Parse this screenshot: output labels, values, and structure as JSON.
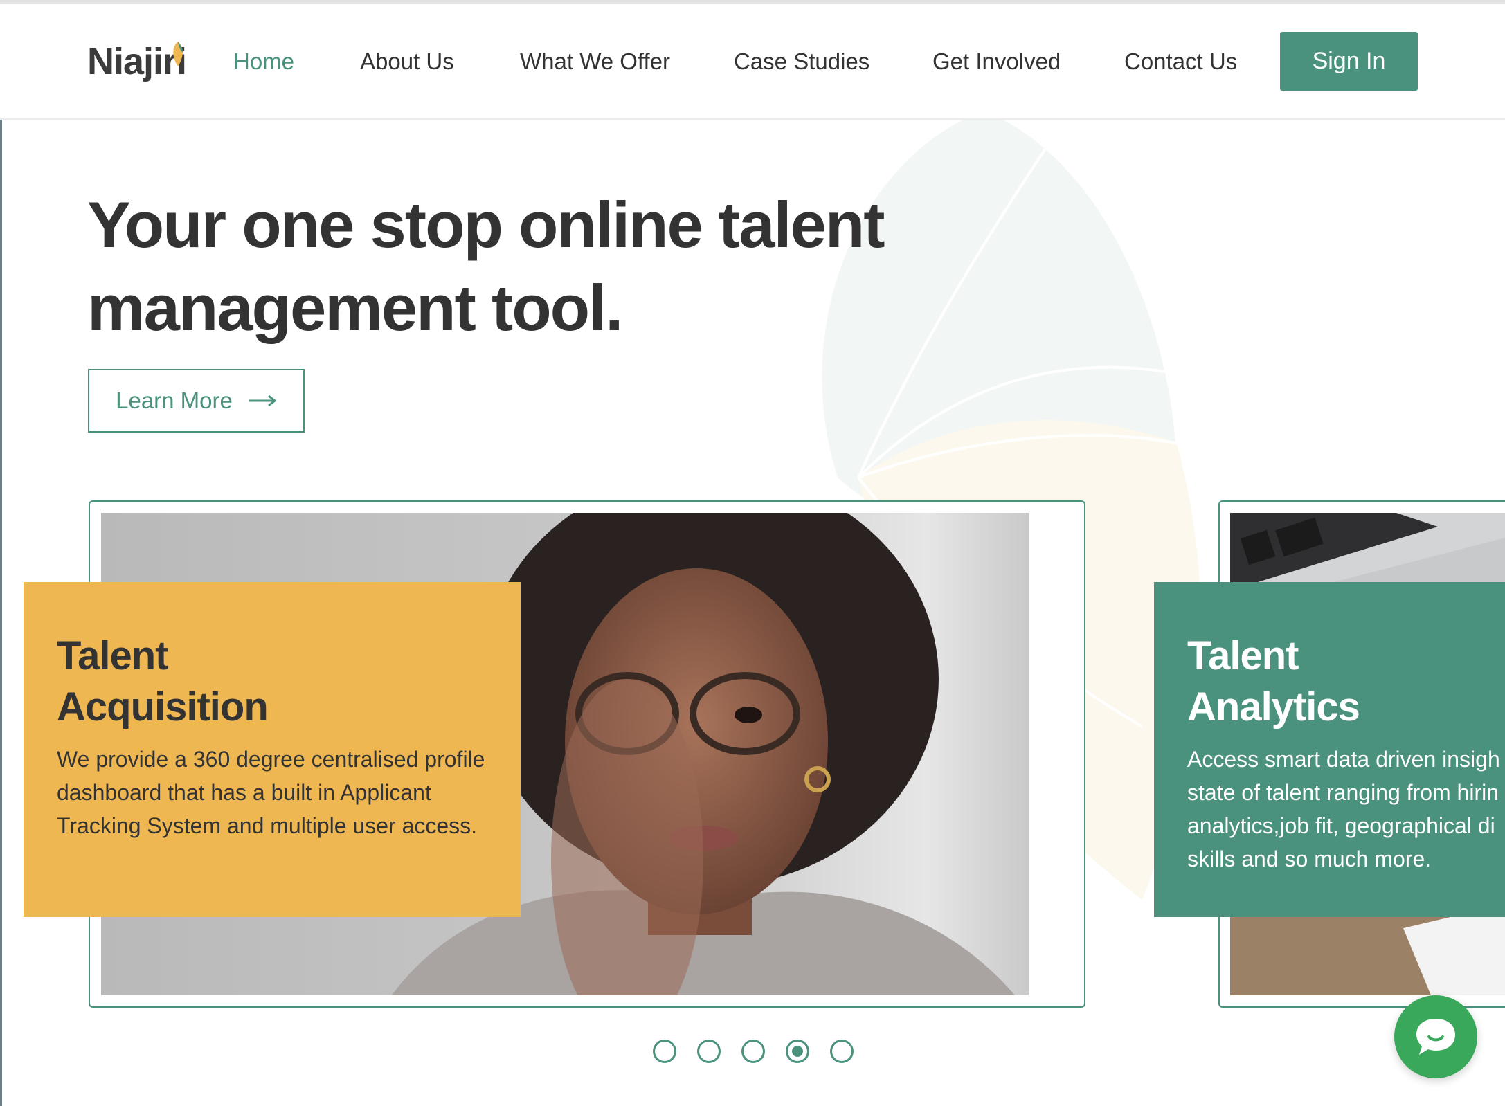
{
  "brand": {
    "logo_text": "Niajiri",
    "accent": "#4a927e",
    "accent_yellow": "#efb752",
    "chat_green": "#3aa85b"
  },
  "nav": {
    "items": [
      {
        "label": "Home",
        "active": true
      },
      {
        "label": "About Us",
        "active": false
      },
      {
        "label": "What We Offer",
        "active": false
      },
      {
        "label": "Case Studies",
        "active": false
      },
      {
        "label": "Get Involved",
        "active": false
      },
      {
        "label": "Contact Us",
        "active": false
      }
    ],
    "signin_label": "Sign In"
  },
  "hero": {
    "title": "Your one stop online talent management tool.",
    "cta_label": "Learn More",
    "cta_icon": "arrow-right-icon"
  },
  "carousel": {
    "cards": [
      {
        "title": "Talent\nAcquisition",
        "text": "We provide a 360 degree centralised profile dashboard that has a built in Applicant Tracking System and multiple user access.",
        "image": "woman-with-glasses-photo",
        "color": "#efb752"
      },
      {
        "title": "Talent\nAnalytics",
        "text_lines": [
          "Access smart data driven insigh",
          "state of talent ranging from hirin",
          "analytics,job fit, geographical di",
          "skills and so much more."
        ],
        "image": "laptop-and-documents-photo",
        "color": "#4a927e"
      }
    ],
    "dots": {
      "count": 5,
      "active_index": 3
    }
  },
  "chat_widget": {
    "icon": "chat-bubble-icon"
  }
}
